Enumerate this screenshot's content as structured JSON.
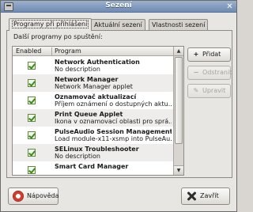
{
  "window": {
    "title": "Sezení",
    "close_glyph": "✕"
  },
  "tabs": [
    {
      "label": "Programy při přihlášení",
      "active": true
    },
    {
      "label": "Aktuální sezení",
      "active": false
    },
    {
      "label": "Vlastnosti sezení",
      "active": false
    }
  ],
  "panel": {
    "section_label": "Další programy po spuštění:"
  },
  "list": {
    "columns": [
      "Enabled",
      "Program"
    ],
    "rows": [
      {
        "enabled": true,
        "name": "Network Authentication",
        "description": "No description"
      },
      {
        "enabled": true,
        "name": "Network Manager",
        "description": "Network Manager applet"
      },
      {
        "enabled": true,
        "name": "Oznamovač aktualizací",
        "description": "Příjem oznámení o dostupných aktu..."
      },
      {
        "enabled": true,
        "name": "Print Queue Applet",
        "description": "Ikona v oznamovací oblasti pro sprá..."
      },
      {
        "enabled": true,
        "name": "PulseAudio Session Management",
        "description": "Load module-x11-xsmp into PulseAu..."
      },
      {
        "enabled": true,
        "name": "SELinux Troubleshooter",
        "description": "No description"
      },
      {
        "enabled": true,
        "name": "Smart Card Manager",
        "description": ""
      }
    ]
  },
  "side_buttons": {
    "add": {
      "label": "Přidat",
      "icon": "plus-icon",
      "disabled": false
    },
    "remove": {
      "label": "Odstranit",
      "icon": "minus-icon",
      "disabled": true
    },
    "edit": {
      "label": "Upravit",
      "icon": "edit-icon",
      "disabled": true
    }
  },
  "bottom_buttons": {
    "help": {
      "label": "Nápověda",
      "icon": "help-lifebuoy-icon"
    },
    "close": {
      "label": "Zavřít",
      "icon": "close-icon"
    }
  },
  "colors": {
    "titlebar": "#7b95bb",
    "window_bg": "#e8e6e3",
    "checkbox_green": "#3c8a18"
  }
}
